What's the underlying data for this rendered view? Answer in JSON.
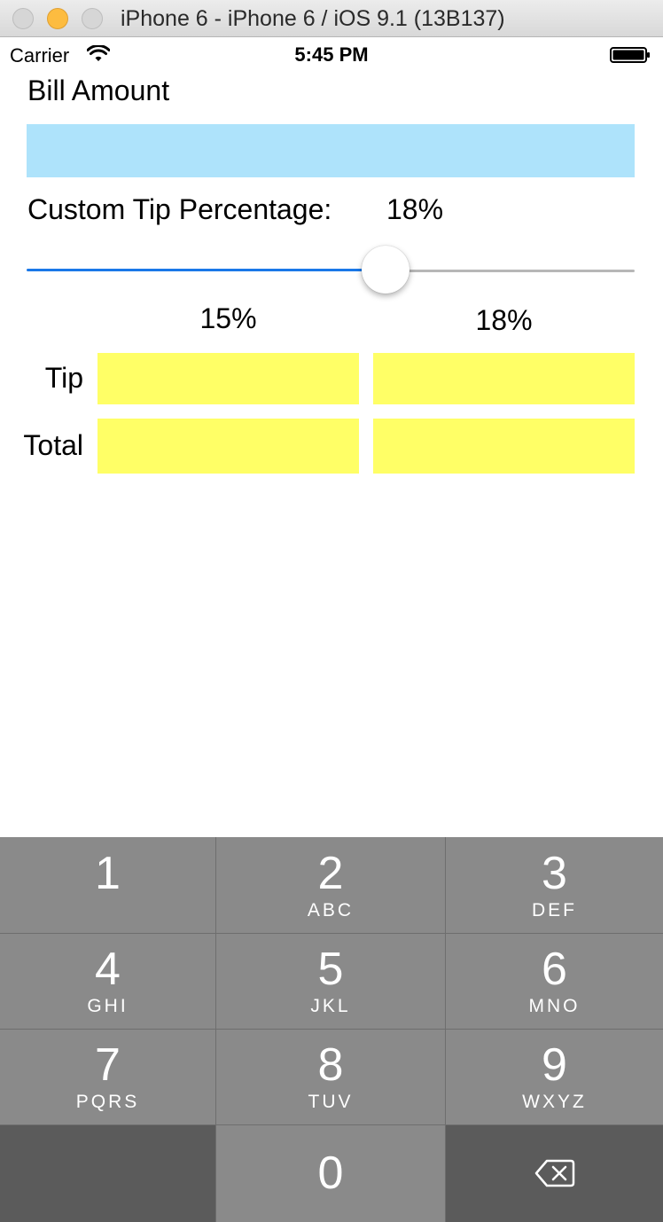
{
  "window": {
    "title": "iPhone 6 - iPhone 6 / iOS 9.1 (13B137)"
  },
  "status_bar": {
    "carrier": "Carrier",
    "time": "5:45 PM"
  },
  "form": {
    "bill_label": "Bill Amount",
    "bill_value": "",
    "custom_tip_label": "Custom Tip Percentage:",
    "custom_tip_value": "18%",
    "slider_fraction": 0.59,
    "columns": [
      "15%",
      "18%"
    ],
    "rows": [
      {
        "label": "Tip",
        "values": [
          "",
          ""
        ]
      },
      {
        "label": "Total",
        "values": [
          "",
          ""
        ]
      }
    ]
  },
  "keypad": {
    "keys": [
      {
        "digit": "1",
        "letters": ""
      },
      {
        "digit": "2",
        "letters": "ABC"
      },
      {
        "digit": "3",
        "letters": "DEF"
      },
      {
        "digit": "4",
        "letters": "GHI"
      },
      {
        "digit": "5",
        "letters": "JKL"
      },
      {
        "digit": "6",
        "letters": "MNO"
      },
      {
        "digit": "7",
        "letters": "PQRS"
      },
      {
        "digit": "8",
        "letters": "TUV"
      },
      {
        "digit": "9",
        "letters": "WXYZ"
      },
      {
        "digit": "0",
        "letters": ""
      }
    ],
    "delete_icon": "backspace-icon"
  },
  "colors": {
    "bill_field": "#aee3fb",
    "result_fields": "#ffff66",
    "slider_track": "#1a78e8",
    "keypad_key": "#8a8a8a",
    "keypad_dark_key": "#5b5b5b"
  }
}
